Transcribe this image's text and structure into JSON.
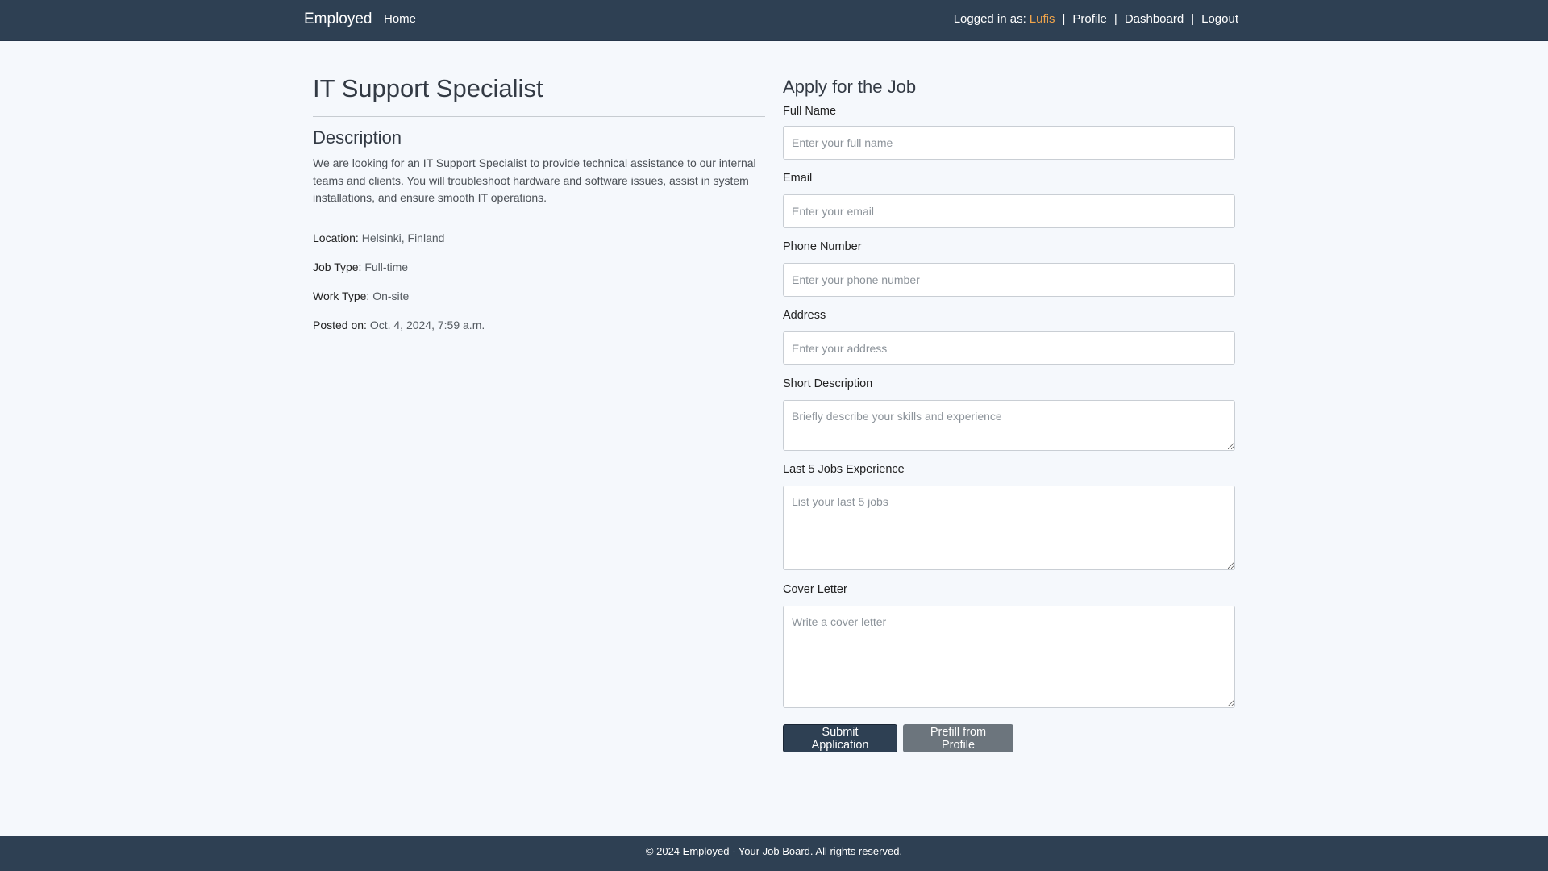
{
  "navbar": {
    "brand": "Employed",
    "home_label": "Home",
    "logged_in_label": "Logged in as:",
    "username": "Lufis",
    "separator": "|",
    "profile_label": "Profile",
    "dashboard_label": "Dashboard",
    "logout_label": "Logout"
  },
  "job": {
    "title": "IT Support Specialist",
    "description_heading": "Description",
    "description": "We are looking for an IT Support Specialist to provide technical assistance to our internal teams and clients. You will troubleshoot hardware and software issues, assist in system installations, and ensure smooth IT operations.",
    "location_label": "Location:",
    "location": "Helsinki, Finland",
    "job_type_label": "Job Type:",
    "job_type": "Full-time",
    "work_type_label": "Work Type:",
    "work_type": "On-site",
    "posted_label": "Posted on:",
    "posted": "Oct. 4, 2024, 7:59 a.m."
  },
  "form": {
    "heading": "Apply for the Job",
    "full_name": {
      "label": "Full Name",
      "placeholder": "Enter your full name",
      "value": ""
    },
    "email": {
      "label": "Email",
      "placeholder": "Enter your email",
      "value": ""
    },
    "phone": {
      "label": "Phone Number",
      "placeholder": "Enter your phone number",
      "value": ""
    },
    "address": {
      "label": "Address",
      "placeholder": "Enter your address",
      "value": ""
    },
    "short_description": {
      "label": "Short Description",
      "placeholder": "Briefly describe your skills and experience",
      "value": ""
    },
    "last_jobs": {
      "label": "Last 5 Jobs Experience",
      "placeholder": "List your last 5 jobs",
      "value": ""
    },
    "cover_letter": {
      "label": "Cover Letter",
      "placeholder": "Write a cover letter",
      "value": ""
    },
    "submit_label": "Submit Application",
    "prefill_label": "Prefill from Profile"
  },
  "footer": {
    "text": "© 2024 Employed - Your Job Board. All rights reserved."
  },
  "colors": {
    "navbar_bg": "#2e4053",
    "accent_username": "#f0a44b",
    "page_bg": "#f5f8fc",
    "secondary_button": "#6c757d"
  }
}
